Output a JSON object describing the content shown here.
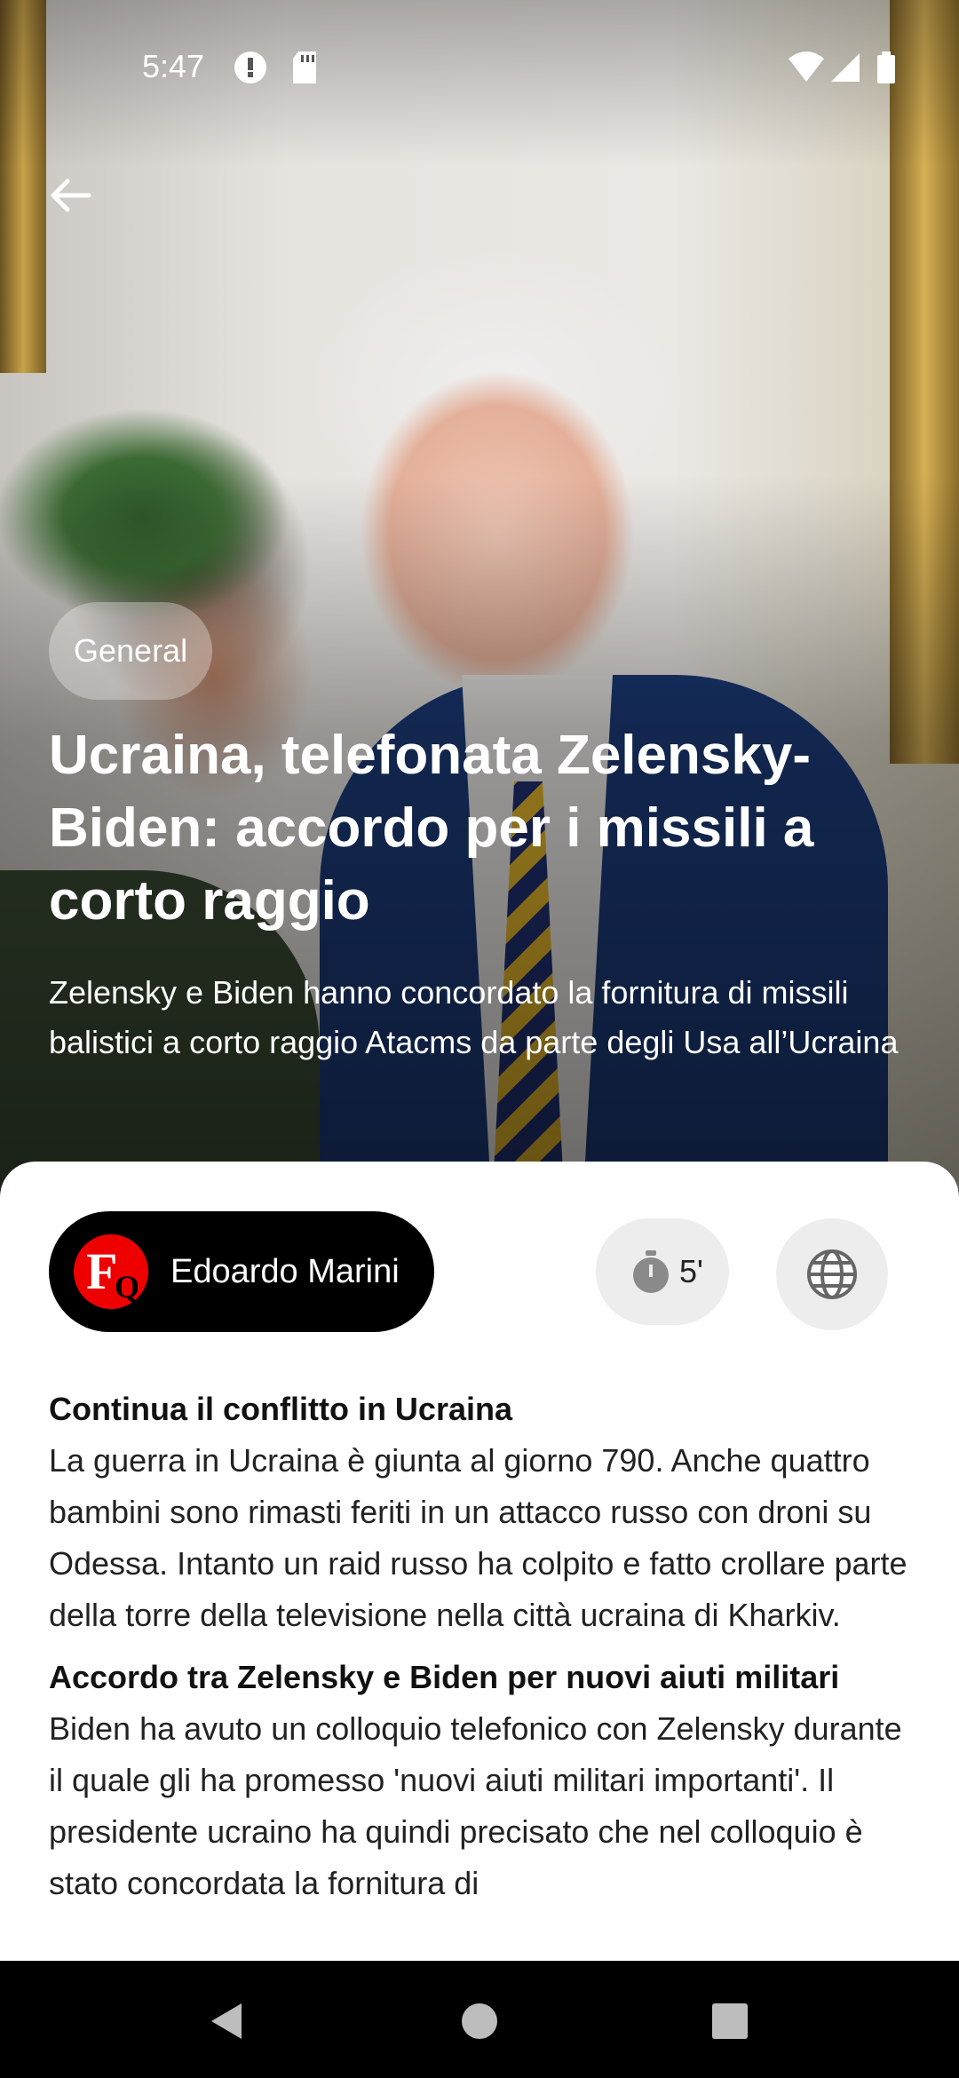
{
  "status_bar": {
    "time": "5:47"
  },
  "hero": {
    "category": "General",
    "headline": "Ucraina, telefonata Zelensky-Biden: accordo per i missili a corto raggio",
    "subheadline": "Zelensky e Biden hanno concordato la fornitura di missili balistici a corto raggio Atacms da parte degli Usa all’Ucraina"
  },
  "meta": {
    "author": "Edoardo Marini",
    "read_time": "5'"
  },
  "article": {
    "sections": [
      {
        "heading": "Continua il conflitto in Ucraina",
        "body": "La guerra in Ucraina è giunta al giorno 790. Anche quattro bambini sono rimasti feriti in un attacco russo con droni su Odessa. Intanto un raid russo ha colpito e fatto crollare parte della torre della televisione nella città ucraina di Kharkiv."
      },
      {
        "heading": "Accordo tra Zelensky e Biden per nuovi aiuti militari",
        "body": "Biden ha avuto un colloquio telefonico con Zelensky durante il quale gli ha promesso 'nuovi aiuti militari importanti'. Il presidente ucraino ha quindi precisato che nel colloquio è stato concordata la fornitura di"
      }
    ]
  },
  "icons": {
    "back": "arrow-left-icon",
    "read_time": "stopwatch-icon",
    "source": "globe-icon"
  }
}
